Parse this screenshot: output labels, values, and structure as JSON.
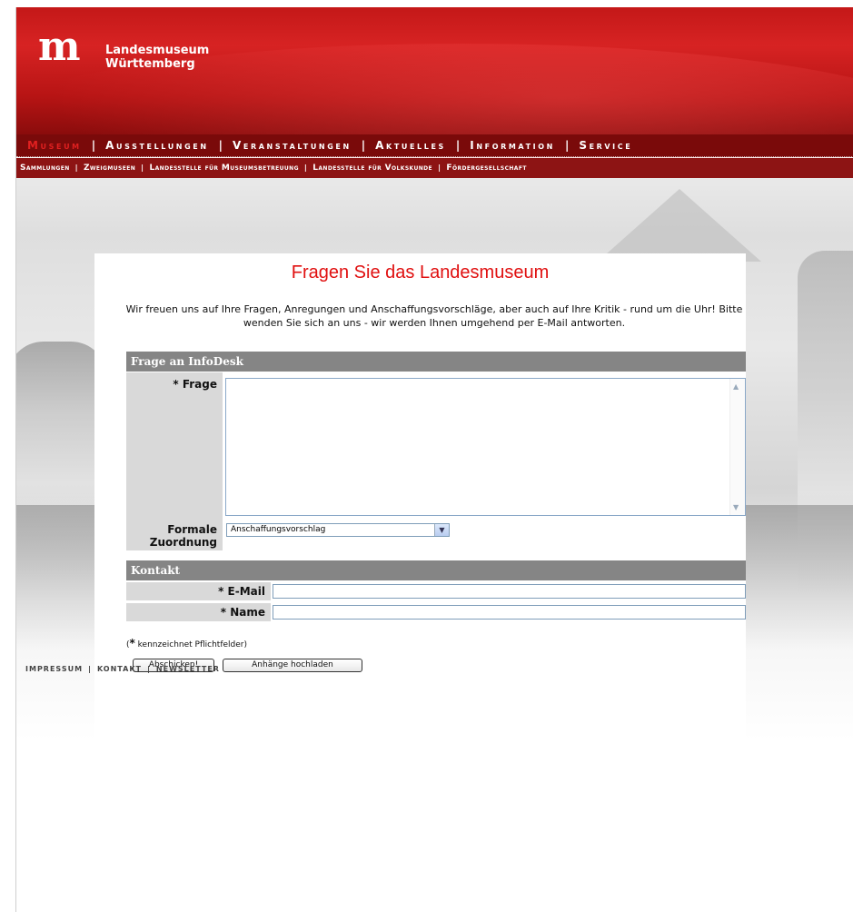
{
  "header": {
    "logo_mark": "m",
    "logo_line1": "Landesmuseum",
    "logo_line2": "Württemberg"
  },
  "main_nav": [
    "Museum",
    "Ausstellungen",
    "Veranstaltungen",
    "Aktuelles",
    "Information",
    "Service"
  ],
  "sub_nav": [
    "Sammlungen",
    "Zweigmuseen",
    "Landesstelle für Museumsbetreuung",
    "Landesstelle für Volkskunde",
    "Fördergesellschaft"
  ],
  "page": {
    "title": "Fragen Sie das Landesmuseum",
    "intro": "Wir freuen uns auf Ihre Fragen, Anregungen und Anschaffungsvorschläge, aber auch auf Ihre Kritik - rund um die Uhr! Bitte wenden Sie sich an uns - wir werden Ihnen umgehend per E-Mail antworten."
  },
  "form": {
    "section1": "Frage an InfoDesk",
    "question_label": "* Frage",
    "category_label": "Formale Zuordnung",
    "category_value": "Anschaffungsvorschlag",
    "section2": "Kontakt",
    "email_label": "* E-Mail",
    "name_label": "* Name",
    "required_note_star": "*",
    "required_note": " kennzeichnet Pflichtfelder)",
    "required_note_open": "(",
    "submit_label": "Abschicken!",
    "upload_label": "Anhänge hochladen"
  },
  "footer": [
    "Impressum",
    "Kontakt",
    "Newsletter"
  ]
}
